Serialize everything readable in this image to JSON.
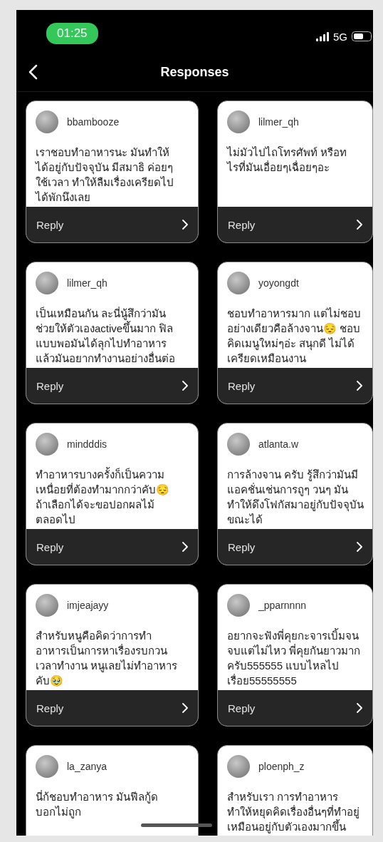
{
  "status_bar": {
    "time": "01:25",
    "network": "5G"
  },
  "header": {
    "title": "Responses"
  },
  "responses": [
    {
      "username": "bbambooze",
      "text": "เราชอบทำอาหารนะ มันทำให้\nได้อยู่กับปัจจุบัน มีสมาธิ ค่อยๆ\nใช้เวลา ทำให้ลืมเรื่องเครียดไป\nได้พักนึงเลย",
      "reply": "Reply"
    },
    {
      "username": "lilmer_qh",
      "text": "ไม่มัวไปไถโทรศัพท์ หรือท\nไรที่มันเอื่อยๆเฉื่อยๆอะ",
      "reply": "Reply"
    },
    {
      "username": "lilmer_qh",
      "text": "เป็นเหมือนกัน ละนี่นู้สึกว่ามัน\nช่วยให้ตัวเองactiveขึ้นมาก ฟิล\nแบบพอมันได้ลุกไปทำอาหาร\nแล้วมันอยากทำงานอย่างอื่นต่อ",
      "reply": "Reply"
    },
    {
      "username": "yoyongdt",
      "text": "ชอบทำอาหารมาก แต่ไม่ชอบ\nอย่างเดียวคือล้างจาน😔 ชอบ\nคิดเมนูใหม่ๆอ่ะ สนุกดี ไม่ได้\nเครียดเหมือนงาน",
      "reply": "Reply"
    },
    {
      "username": "mindddis",
      "text": "ทำอาหารบางครั้งก็เป็นความ\nเหนื่อยที่ต้องทำมากกว่าคับ😔\nถ้าเลือกได้จะขอปอกผลไม้\nตลอดไป",
      "reply": "Reply"
    },
    {
      "username": "atlanta.w",
      "text": "การล้างจาน ครับ รู้สึกว่ามันมี\nแอคชั่นเช่นการถูๆ วนๆ มัน\nทำให้ดึงโฟกัสมาอยู่กับปัจจุบัน\nขณะได้",
      "reply": "Reply"
    },
    {
      "username": "imjeajayy",
      "text": "สำหรับหนูคือคิดว่าการทำ\nอาหารเป็นการหาเรื่องรบกวน\nเวลาทำงาน หนูเลยไม่ทำอาหาร\nคับ🥹",
      "reply": "Reply"
    },
    {
      "username": "_pparnnnn",
      "text": "อยากจะฟังพี่คุยกะจารเบิ้มจน\nจบแต่ไม่ไหว พี่คุยกันยาวมาก\nครับ555555 แบบไหลไป\nเรื่อย55555555",
      "reply": "Reply"
    },
    {
      "username": "la_zanya",
      "text": "นี่ก้ชอบทำอาหาร มันฟีลกู้ด\nบอกไม่ถูก"
    },
    {
      "username": "ploenph_z",
      "text": "สำหรับเรา การทำอาหาร\nทำให้หยุดคิดเรื่องอื่นๆที่ทำอยู่\nเหมือนอยู่กับตัวเองมากขึ้น"
    }
  ]
}
